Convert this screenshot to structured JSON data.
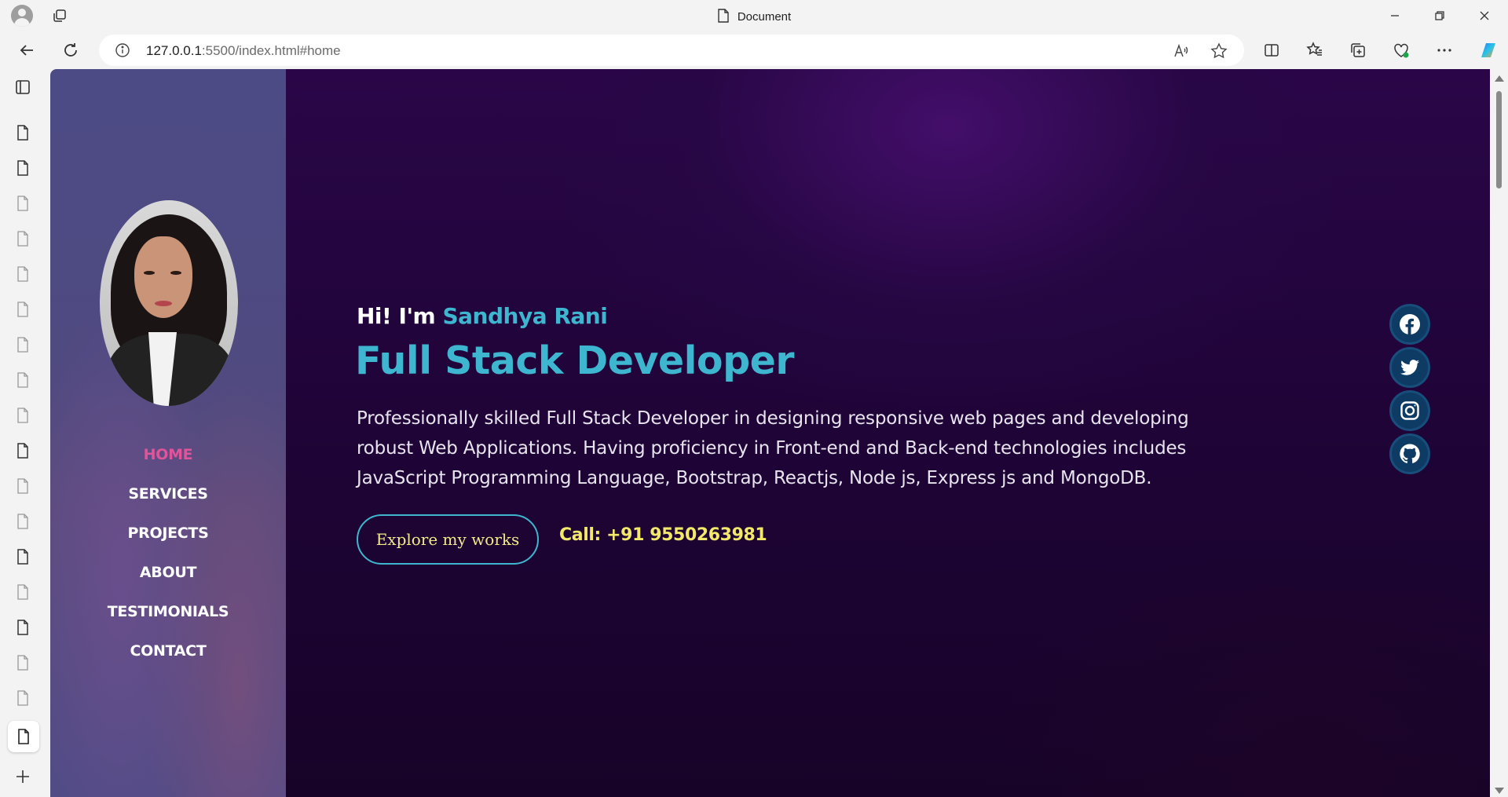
{
  "window": {
    "title": "Document"
  },
  "addressbar": {
    "url_host": "127.0.0.1",
    "url_rest": ":5500/index.html#home"
  },
  "sidebar": {
    "nav_items": [
      {
        "label": "HOME",
        "active": true
      },
      {
        "label": "SERVICES",
        "active": false
      },
      {
        "label": "PROJECTS",
        "active": false
      },
      {
        "label": "ABOUT",
        "active": false
      },
      {
        "label": "TESTIMONIALS",
        "active": false
      },
      {
        "label": "CONTACT",
        "active": false
      }
    ]
  },
  "hero": {
    "greeting": "Hi! I'm",
    "name": "Sandhya Rani",
    "role": "Full Stack Developer",
    "description": "Professionally skilled Full Stack Developer in designing responsive web pages and developing robust Web Applications. Having proficiency in Front-end and Back-end technologies includes JavaScript Programming Language, Bootstrap, Reactjs, Node js, Express js and MongoDB.",
    "cta_label": "Explore my works",
    "call_text": "Call: +91 9550263981"
  },
  "social_links": [
    "facebook-icon",
    "twitter-icon",
    "instagram-icon",
    "github-icon"
  ],
  "colors": {
    "accent_cyan": "#3fb6cf",
    "nav_active_pink": "#e0559a",
    "call_yellow": "#f2e86a",
    "main_bg": "#1f0437",
    "sidebar_bg": "#4f4a80"
  }
}
